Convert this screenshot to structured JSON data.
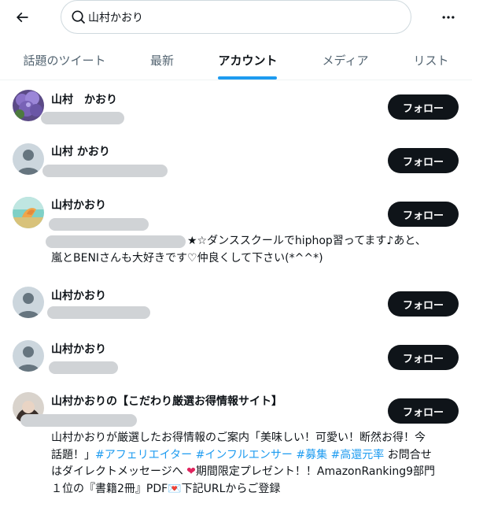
{
  "search": {
    "value": "山村かおり"
  },
  "icons": {
    "back": "arrow-left-icon",
    "search": "search-icon",
    "more": "more-horizontal-icon"
  },
  "colors": {
    "accent": "#1d9bf0",
    "text": "#0f1419",
    "secondary": "#536471",
    "button": "#0f1419"
  },
  "tabs": [
    {
      "label": "話題のツイート",
      "active": false
    },
    {
      "label": "最新",
      "active": false
    },
    {
      "label": "アカウント",
      "active": true
    },
    {
      "label": "メディア",
      "active": false
    },
    {
      "label": "リスト",
      "active": false
    }
  ],
  "users": [
    {
      "name": "山村　かおり",
      "follow_label": "フォロー",
      "avatar": "hydrangea-photo"
    },
    {
      "name": "山村 かおり",
      "follow_label": "フォロー",
      "avatar": "default-avatar"
    },
    {
      "name": "山村かおり",
      "follow_label": "フォロー",
      "avatar": "beach-photo",
      "bio_line1": "★☆ダンススクールでhiphop習ってます♪あと、",
      "bio_line2": "嵐とBENIさんも大好きです♡仲良くして下さい(*^^*)"
    },
    {
      "name": "山村かおり",
      "follow_label": "フォロー",
      "avatar": "default-avatar"
    },
    {
      "name": "山村かおり",
      "follow_label": "フォロー",
      "avatar": "default-avatar"
    },
    {
      "name": "山村かおりの【こだわり厳選お得情報サイト】",
      "follow_label": "フォロー",
      "avatar": "portrait-photo",
      "bio": {
        "l1": "山村かおりが厳選したお得情報のご案内「美味しい！可愛い！断然お得！今",
        "l2_a": "話題！」",
        "tag1": "#アフェリエイター",
        "tag2": "#インフルエンサー",
        "tag3": "#募集",
        "tag4": "#高還元率",
        "l2_b": " お問合せ",
        "l3_a": "はダイレクトメッセージへ ",
        "heart": "❤",
        "l3_b": "期間限定プレゼント！！AmazonRanking9部門",
        "l4_a": "１位の『書籍2冊』PDF",
        "l4_icon": "💌",
        "l4_b": "下記URLからご登録"
      }
    }
  ]
}
